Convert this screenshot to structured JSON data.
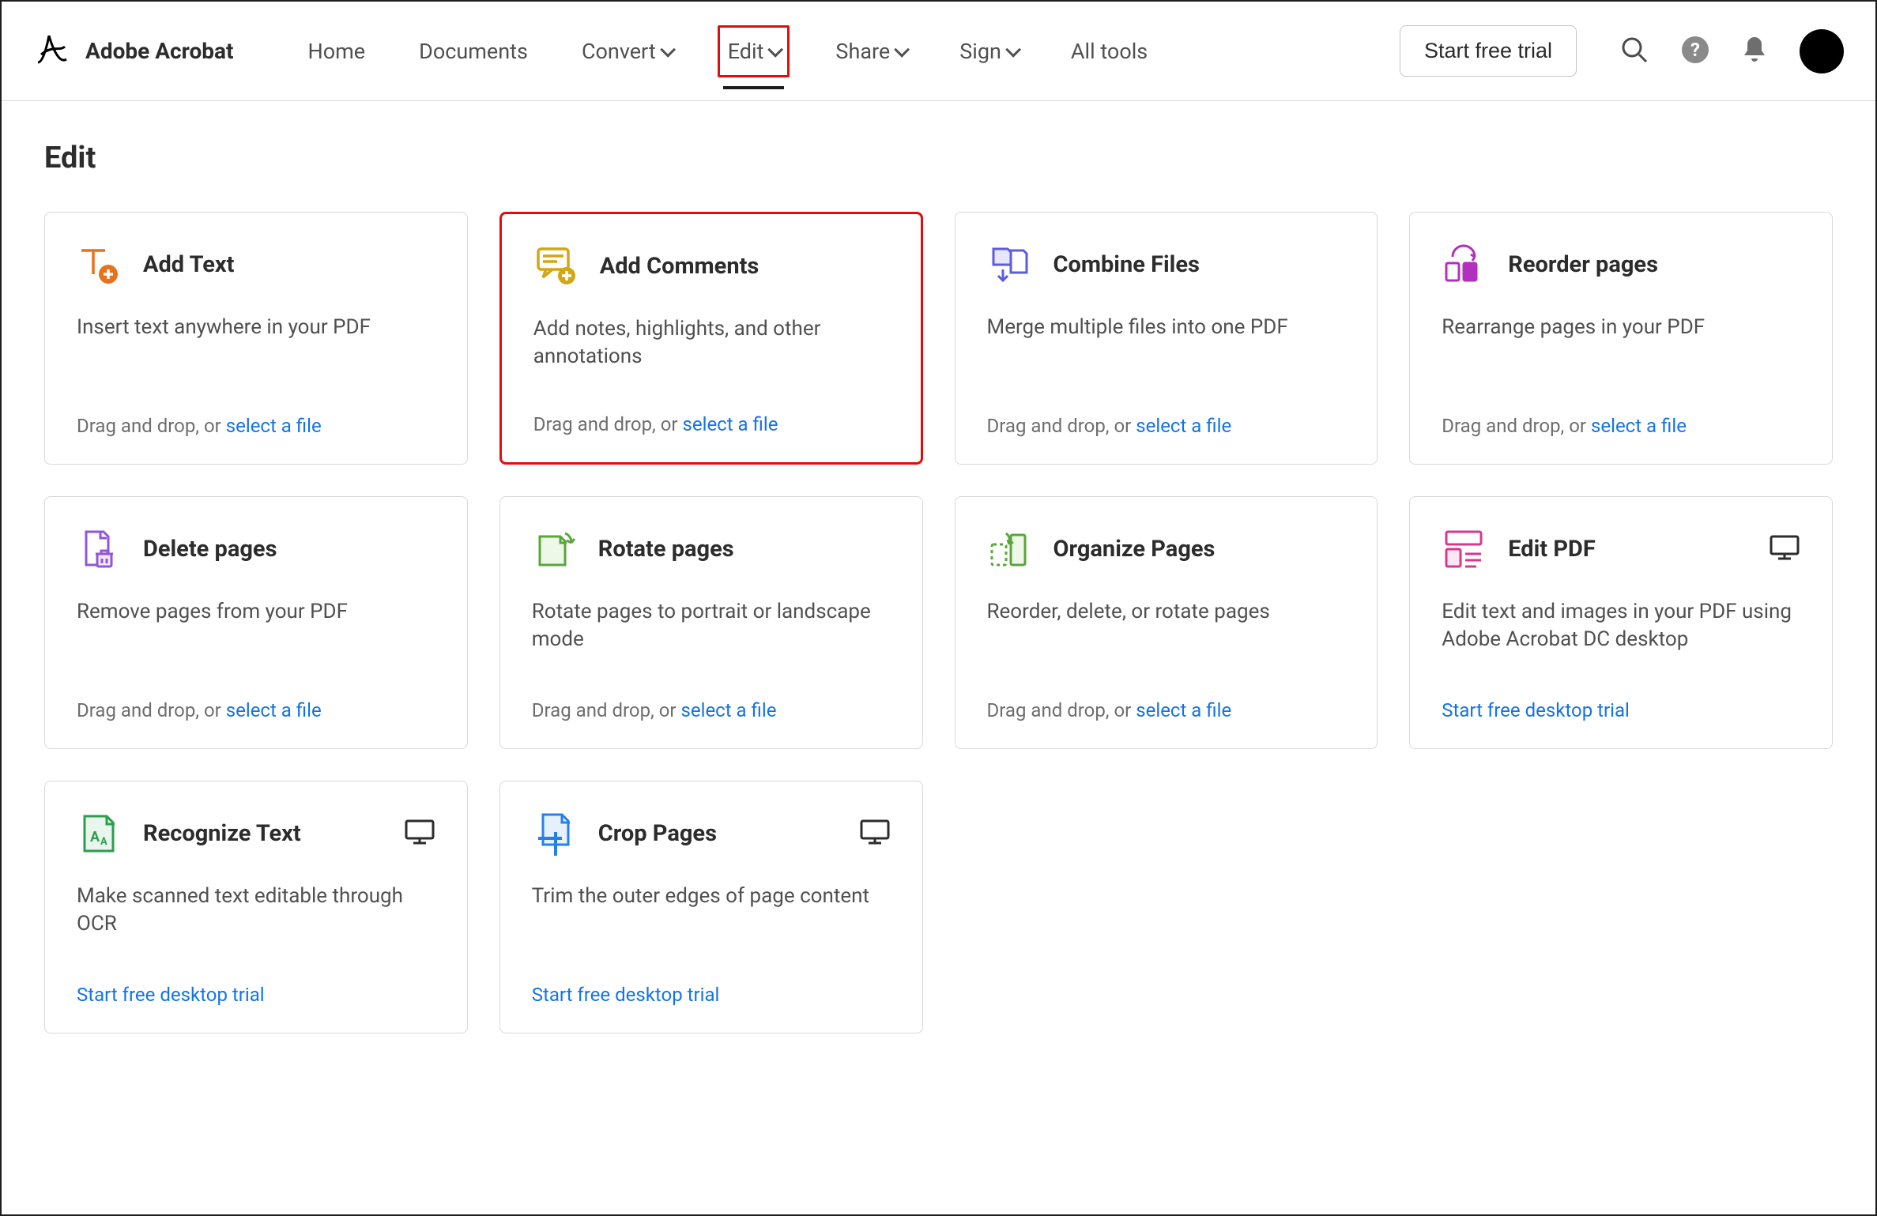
{
  "header": {
    "brand": "Adobe Acrobat",
    "nav": {
      "home": "Home",
      "documents": "Documents",
      "convert": "Convert",
      "edit": "Edit",
      "share": "Share",
      "sign": "Sign",
      "all_tools": "All tools"
    },
    "cta": "Start free trial"
  },
  "page": {
    "title": "Edit"
  },
  "drag_prefix": "Drag and drop, or ",
  "select_file": "select a file",
  "desktop_trial": "Start free desktop trial",
  "cards": {
    "add_text": {
      "title": "Add Text",
      "desc": "Insert text anywhere in your PDF"
    },
    "add_comments": {
      "title": "Add Comments",
      "desc": "Add notes, highlights, and other annotations"
    },
    "combine": {
      "title": "Combine Files",
      "desc": "Merge multiple files into one PDF"
    },
    "reorder": {
      "title": "Reorder pages",
      "desc": "Rearrange pages in your PDF"
    },
    "delete": {
      "title": "Delete pages",
      "desc": "Remove pages from your PDF"
    },
    "rotate": {
      "title": "Rotate pages",
      "desc": "Rotate pages to portrait or landscape mode"
    },
    "organize": {
      "title": "Organize Pages",
      "desc": "Reorder, delete, or rotate pages"
    },
    "edit_pdf": {
      "title": "Edit PDF",
      "desc": "Edit text and images in your PDF using Adobe Acrobat DC desktop"
    },
    "recognize": {
      "title": "Recognize Text",
      "desc": "Make scanned text editable through OCR"
    },
    "crop": {
      "title": "Crop Pages",
      "desc": "Trim the outer edges of page content"
    }
  }
}
